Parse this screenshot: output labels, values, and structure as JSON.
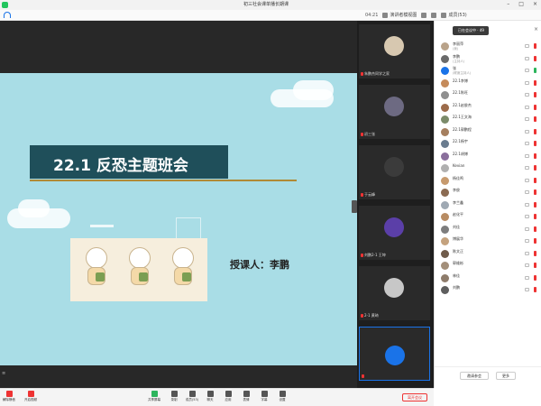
{
  "window": {
    "title": "初三社会课单播长期课"
  },
  "toolbar": {
    "time": "04:21",
    "items": [
      {
        "icon": "grid-view-icon",
        "label": "演讲者模视图"
      },
      {
        "icon": "fullscreen-icon",
        "label": ""
      },
      {
        "icon": "fullscreen-icon",
        "label": ""
      },
      {
        "icon": "participants-icon",
        "label": "成员(53)"
      }
    ]
  },
  "win_controls": [
    "–",
    "□",
    "×"
  ],
  "slide": {
    "title": "22.1 反恐主题班会",
    "teacher": "授课人：李鹏"
  },
  "video_tiles": [
    {
      "name": "朱鹏杰同学之家",
      "avatar_color": "#d7c8b0"
    },
    {
      "name": "初三张",
      "avatar_color": "#6d6a82"
    },
    {
      "name": "于云峰",
      "avatar_color": "#3b3b3b"
    },
    {
      "name": "刘鹏2-1 王坤",
      "avatar_color": "#5b3fa8"
    },
    {
      "name": "2-1 黄琦",
      "avatar_color": "#c7c7c7"
    },
    {
      "name": "",
      "avatar_color": "#1a73e8"
    }
  ],
  "panel": {
    "header_label": "已在会议中 · 49",
    "participants": [
      {
        "name": "李丽萍",
        "sub": "(我)",
        "mic": "off",
        "color": "#b9a38a"
      },
      {
        "name": "李鹏",
        "sub": "(主持人)",
        "mic": "off",
        "color": "#6a6a6a"
      },
      {
        "name": "张",
        "sub": "(联席主持人)",
        "mic": "on",
        "color": "#1a73e8"
      },
      {
        "name": "22.1李博",
        "sub": "",
        "mic": "off",
        "color": "#c58b5b"
      },
      {
        "name": "22.1陈旺",
        "sub": "",
        "mic": "off",
        "color": "#8f8f8f"
      },
      {
        "name": "22.1赵俊杰",
        "sub": "",
        "mic": "off",
        "color": "#9c6b4a"
      },
      {
        "name": "22.1王文海",
        "sub": "",
        "mic": "off",
        "color": "#7b8b6a"
      },
      {
        "name": "22.1郭鹏程",
        "sub": "",
        "mic": "off",
        "color": "#a57f5f"
      },
      {
        "name": "22.1杨宇",
        "sub": "",
        "mic": "off",
        "color": "#6a7c8f"
      },
      {
        "name": "22.1胡博",
        "sub": "",
        "mic": "off",
        "color": "#8a6f9c"
      },
      {
        "name": "Kevian",
        "sub": "",
        "mic": "off",
        "color": "#b0b0b0"
      },
      {
        "name": "杨佳鸣",
        "sub": "",
        "mic": "off",
        "color": "#c79a6e"
      },
      {
        "name": "李俊",
        "sub": "",
        "mic": "off",
        "color": "#8b6b52"
      },
      {
        "name": "李兰鑫",
        "sub": "",
        "mic": "off",
        "color": "#9fa9b3"
      },
      {
        "name": "赵化平",
        "sub": "",
        "mic": "off",
        "color": "#b88c63"
      },
      {
        "name": "刘佳",
        "sub": "",
        "mic": "off",
        "color": "#7d7d7d"
      },
      {
        "name": "博展华",
        "sub": "",
        "mic": "off",
        "color": "#c4a27e"
      },
      {
        "name": "陈文正",
        "sub": "",
        "mic": "off",
        "color": "#6f5b4a"
      },
      {
        "name": "郭维彬",
        "sub": "",
        "mic": "off",
        "color": "#a38f7a"
      },
      {
        "name": "林佳",
        "sub": "",
        "mic": "off",
        "color": "#8e7c6b"
      },
      {
        "name": "刘鹏",
        "sub": "",
        "mic": "off",
        "color": "#5e5e5e"
      }
    ],
    "invite_label": "邀请参会",
    "more_label": "更多"
  },
  "bottombar": {
    "items": [
      {
        "icon": "mic-icon",
        "label": "解除静音"
      },
      {
        "icon": "video-icon",
        "label": "开启视频"
      },
      {
        "icon": "share-screen-icon",
        "label": "共享屏幕"
      },
      {
        "icon": "record-icon",
        "label": "录制"
      },
      {
        "icon": "participants-icon",
        "label": "成员(53)"
      },
      {
        "icon": "chat-icon",
        "label": "聊天"
      },
      {
        "icon": "apps-icon",
        "label": "应用"
      },
      {
        "icon": "reaction-icon",
        "label": "表情"
      },
      {
        "icon": "caption-icon",
        "label": "字幕"
      },
      {
        "icon": "settings-icon",
        "label": "设置"
      }
    ],
    "end_label": "离开会议"
  }
}
